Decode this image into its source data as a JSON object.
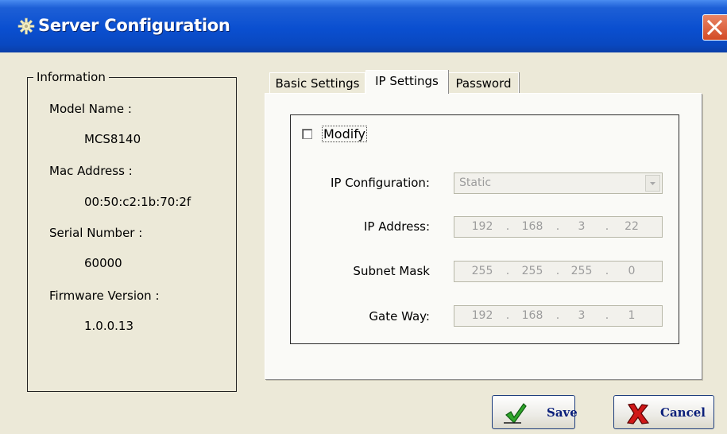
{
  "window": {
    "title": "Server Configuration"
  },
  "information": {
    "legend": "Information",
    "model_name_label": "Model Name :",
    "model_name": "MCS8140",
    "mac_label": "Mac Address :",
    "mac": "00:50:c2:1b:70:2f",
    "serial_label": "Serial Number :",
    "serial": "60000",
    "firmware_label": "Firmware Version :",
    "firmware": "1.0.0.13"
  },
  "tabs": [
    {
      "label": "Basic Settings",
      "active": false
    },
    {
      "label": "IP Settings",
      "active": true
    },
    {
      "label": "Password",
      "active": false
    }
  ],
  "ip_settings": {
    "modify_label": "Modify",
    "modify_checked": false,
    "ip_config_label": "IP Configuration:",
    "ip_config_value": "Static",
    "ip_address_label": "IP Address:",
    "ip_address": [
      "192",
      "168",
      "3",
      "22"
    ],
    "subnet_label": "Subnet Mask",
    "subnet": [
      "255",
      "255",
      "255",
      "0"
    ],
    "gateway_label": "Gate Way:",
    "gateway": [
      "192",
      "168",
      "3",
      "1"
    ]
  },
  "buttons": {
    "save_label": "Save",
    "cancel_label": "Cancel"
  },
  "colors": {
    "titlebar": "#0a4fd0",
    "dialog_bg": "#ece9d8",
    "panel_bg": "#fafaf7",
    "button_text": "#0a1f7a"
  }
}
